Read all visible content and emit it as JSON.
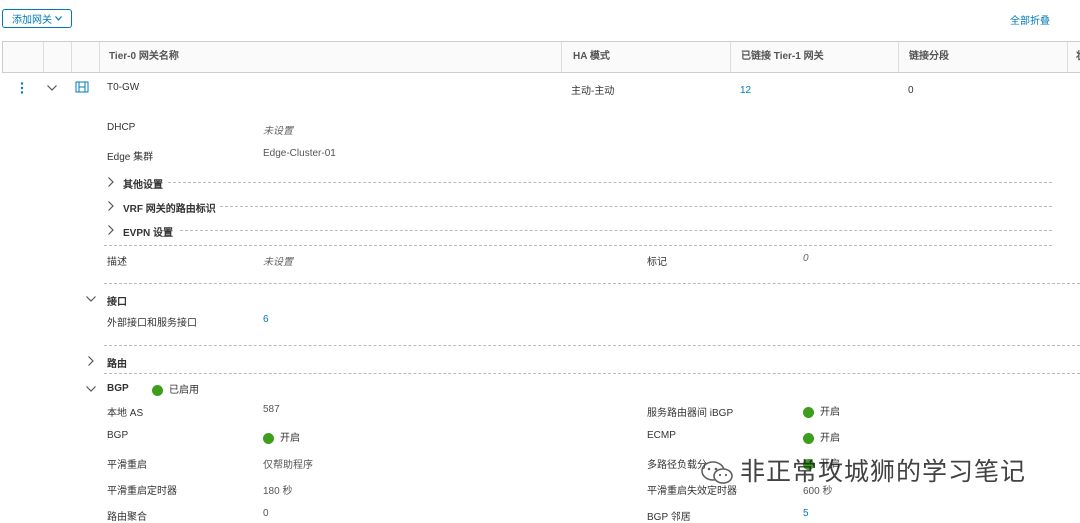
{
  "toolbar": {
    "add_gateway": "添加网关",
    "collapse_all": "全部折叠"
  },
  "table": {
    "headers": [
      "Tier-0 网关名称",
      "HA 模式",
      "已链接 Tier-1 网关",
      "链接分段",
      "状"
    ],
    "row": {
      "name": "T0-GW",
      "ha_mode": "主动-主动",
      "tier1_count": "12",
      "segments": "0"
    }
  },
  "details": {
    "dhcp_label": "DHCP",
    "dhcp_value": "未设置",
    "edge_cluster_label": "Edge 集群",
    "edge_cluster_value": "Edge-Cluster-01",
    "other_settings": "其他设置",
    "vrf_route": "VRF 网关的路由标识",
    "evpn": "EVPN 设置",
    "desc_label": "描述",
    "desc_value": "未设置",
    "tag_label": "标记",
    "tag_value": "0"
  },
  "interfaces": {
    "title": "接口",
    "label": "外部接口和服务接口",
    "count": "6"
  },
  "routing": {
    "title": "路由"
  },
  "bgp": {
    "title": "BGP",
    "status": "已启用",
    "local_as_label": "本地 AS",
    "local_as_value": "587",
    "bgp_label": "BGP",
    "bgp_value": "开启",
    "graceful_label": "平滑重启",
    "graceful_value": "仅帮助程序",
    "graceful_timer_label": "平滑重启定时器",
    "graceful_timer_value": "180 秒",
    "route_agg_label": "路由聚合",
    "route_agg_value": "0",
    "ibgp_label": "服务路由器间 iBGP",
    "ibgp_value": "开启",
    "ecmp_label": "ECMP",
    "ecmp_value": "开启",
    "multipath_label": "多路径负载分",
    "multipath_value": "开启",
    "stale_timer_label": "平滑重启失效定时器",
    "stale_timer_value": "600 秒",
    "neighbors_label": "BGP 邻居",
    "neighbors_value": "5"
  },
  "watermark": "非正常攻城狮的学习笔记",
  "colors": {
    "accent": "#0079b8",
    "enabled": "#3c9e1a"
  }
}
